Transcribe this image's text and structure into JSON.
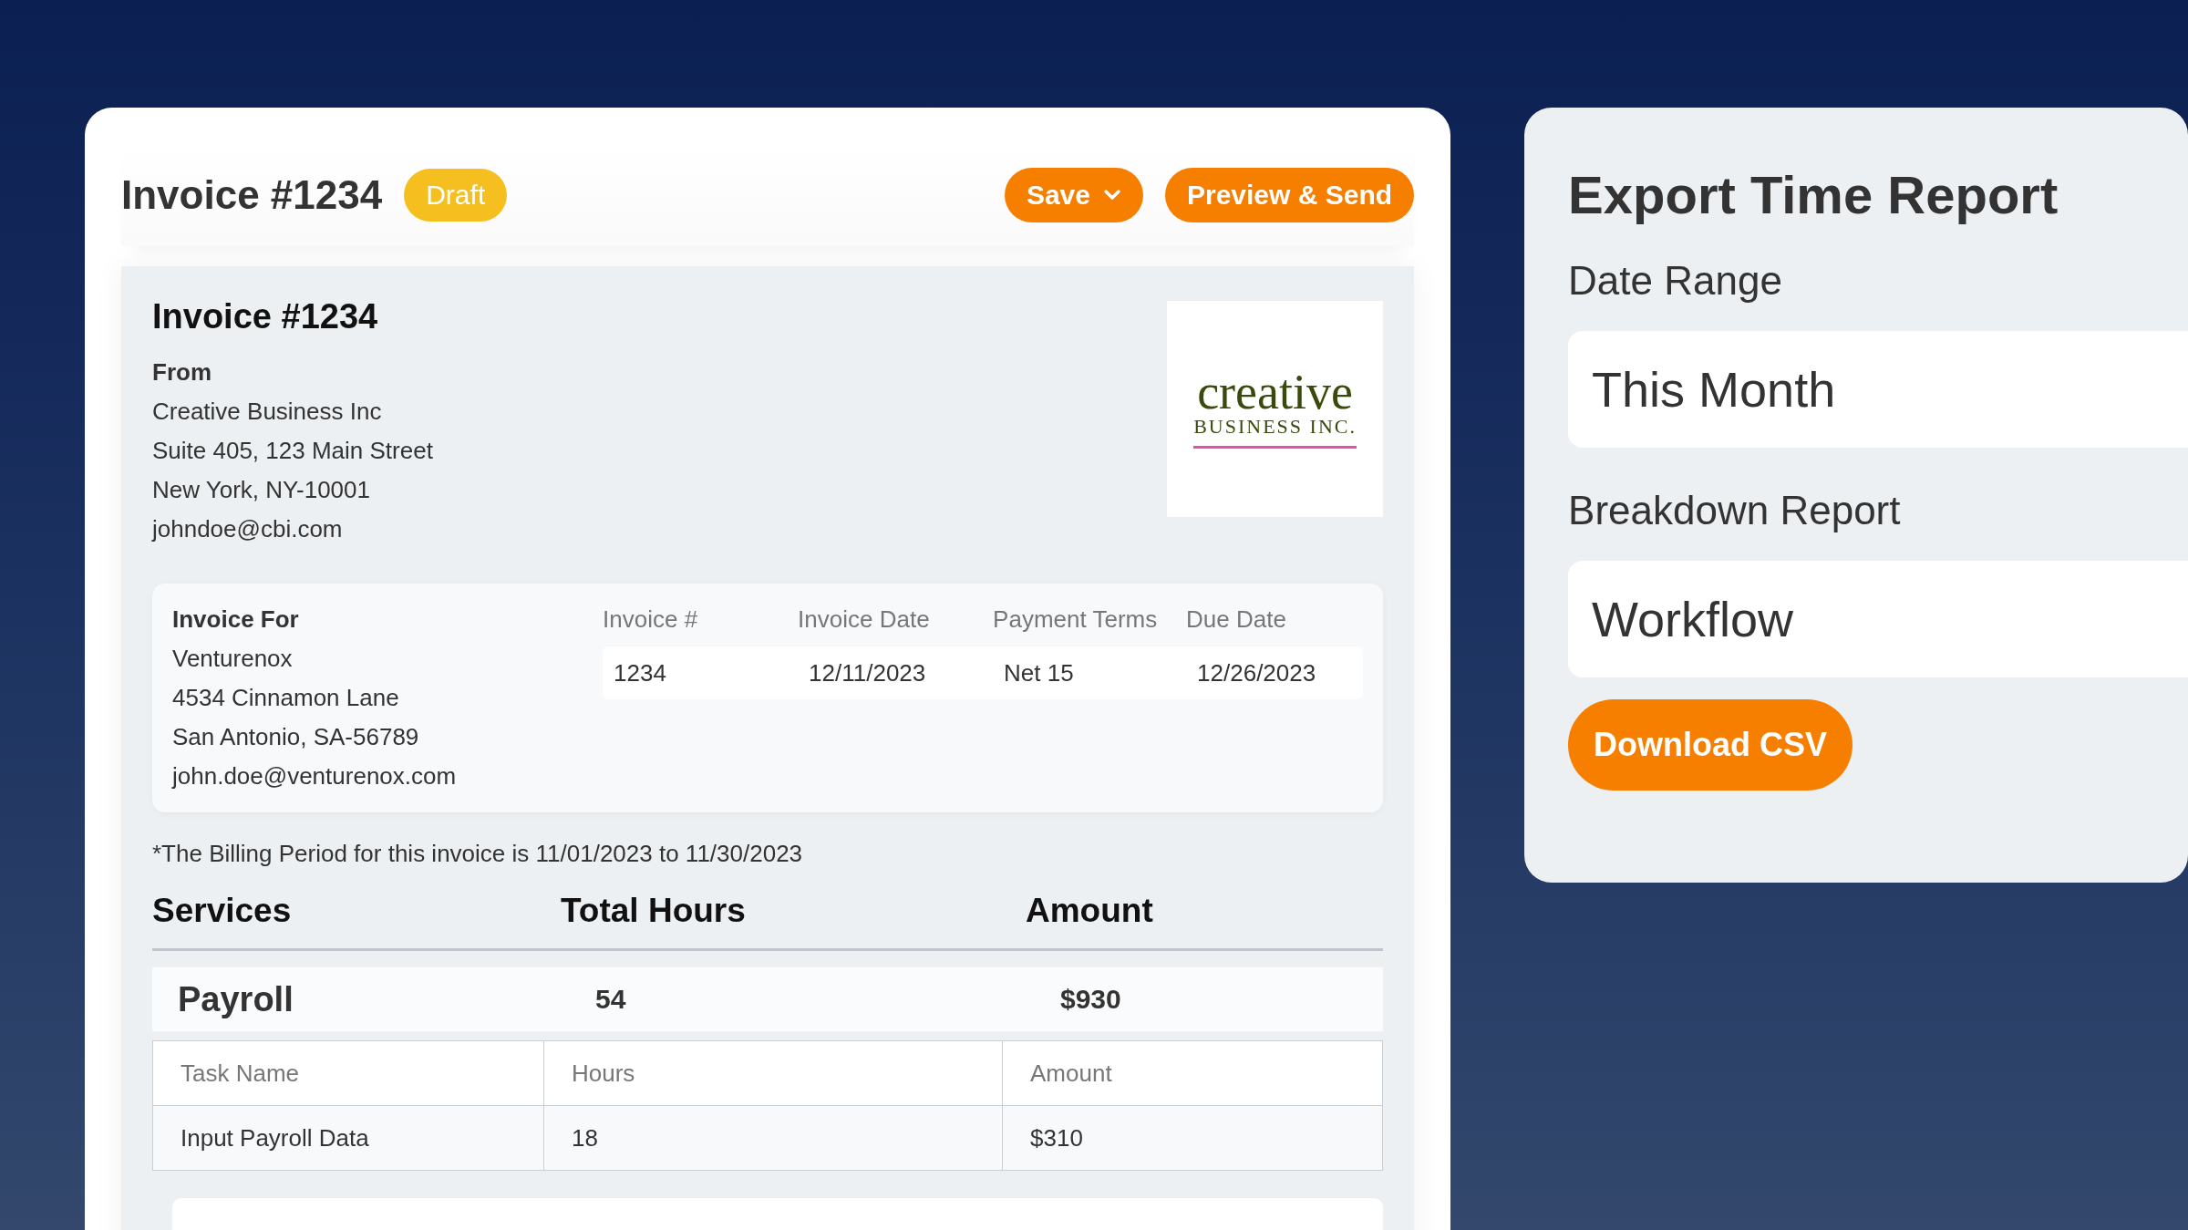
{
  "invoice_editor": {
    "title": "Invoice #1234",
    "status_badge": "Draft",
    "buttons": [
      {
        "label": "Save",
        "kind": "dropdown"
      },
      {
        "label": "Preview & Send",
        "kind": "plain"
      }
    ]
  },
  "invoice": {
    "title": "Invoice #1234",
    "from_label": "From",
    "from_lines": [
      "Creative Business Inc",
      "Suite 405, 123 Main Street",
      "New York, NY-10001",
      "johndoe@cbi.com"
    ],
    "logo": {
      "name": "creative",
      "tagline": "BUSINESS INC."
    },
    "bill_to_label": "Invoice For",
    "bill_to_lines": [
      "Venturenox",
      "4534 Cinnamon Lane",
      "San Antonio, SA-56789",
      "john.doe@venturenox.com"
    ],
    "details_columns": [
      "Invoice #",
      "Invoice Date",
      "Payment Terms",
      "Due Date"
    ],
    "details_values": [
      "1234",
      "12/11/2023",
      "Net 15",
      "12/26/2023"
    ],
    "billing_note": "*The Billing Period for this invoice is 11/01/2023 to 11/30/2023",
    "services_columns": [
      "Services",
      "Total Hours",
      "Amount"
    ],
    "service": {
      "name": "Payroll",
      "total_hours": "54",
      "amount": "$930",
      "task_columns": [
        "Task Name",
        "Hours",
        "Amount"
      ],
      "tasks": [
        [
          "Input Payroll Data",
          "18",
          "$310"
        ]
      ]
    }
  },
  "export_panel": {
    "title": "Export Time Report",
    "fields": [
      {
        "label": "Date Range",
        "value": "This Month"
      },
      {
        "label": "Breakdown Report",
        "value": "Workflow"
      }
    ],
    "button": "Download CSV"
  }
}
